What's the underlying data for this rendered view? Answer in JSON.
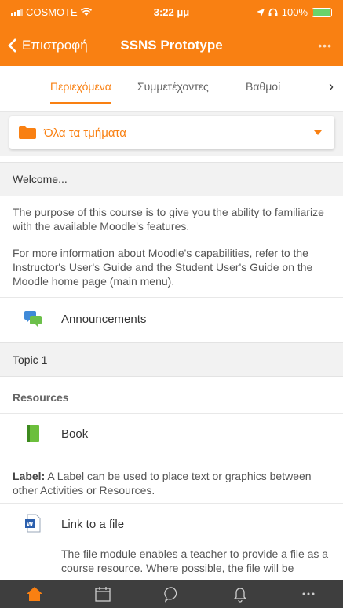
{
  "status_bar": {
    "carrier": "COSMOTE",
    "time": "3:22 μμ",
    "battery": "100%"
  },
  "nav": {
    "back_label": "Επιστροφή",
    "title": "SSNS Prototype"
  },
  "tabs": [
    {
      "label": "Περιεχόμενα",
      "active": true
    },
    {
      "label": "Συμμετέχοντες",
      "active": false
    },
    {
      "label": "Βαθμοί",
      "active": false
    }
  ],
  "section_selector": {
    "value": "Όλα τα τμήματα"
  },
  "sections": {
    "welcome": {
      "title": "Welcome...",
      "paragraph_1": "The purpose of this course is to give you the ability to familiarize with the  available Moodle's features.",
      "paragraph_2": "For more information about Moodle's capabilities, refer to the Instructor's User's Guide and the Student User's Guide on the Moodle home page (main menu).",
      "activity": "Announcements"
    },
    "topic1": {
      "title": "Topic 1",
      "subheading": "Resources",
      "book": "Book",
      "label_prefix": "Label:",
      "label_text": " A Label can be used to place text or graphics between other Activities or Resources.",
      "link_file": "Link to a file",
      "file_description": "The file module enables a teacher to provide a file as a course resource. Where possible, the file will be"
    }
  },
  "colors": {
    "accent": "#f98012",
    "section_bg": "#f2f2f2",
    "bottom_bar": "#3e3e3e"
  },
  "bottom_bar": {
    "icons": [
      "home-icon",
      "calendar-icon",
      "messages-icon",
      "notifications-icon",
      "more-icon"
    ]
  }
}
